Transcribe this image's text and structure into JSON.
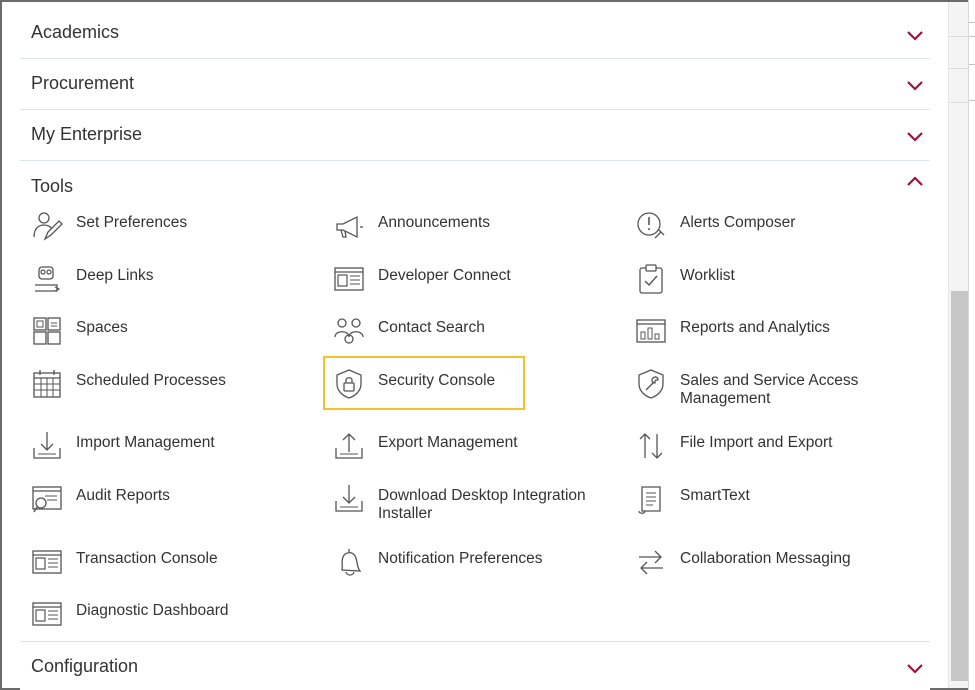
{
  "sections": {
    "academics": "Academics",
    "procurement": "Procurement",
    "my_enterprise": "My Enterprise",
    "tools": "Tools",
    "configuration": "Configuration"
  },
  "tools": {
    "set_preferences": "Set Preferences",
    "announcements": "Announcements",
    "alerts_composer": "Alerts Composer",
    "deep_links": "Deep Links",
    "developer_connect": "Developer Connect",
    "worklist": "Worklist",
    "spaces": "Spaces",
    "contact_search": "Contact Search",
    "reports_and_analytics": "Reports and Analytics",
    "scheduled_processes": "Scheduled Processes",
    "security_console": "Security Console",
    "sales_service_access": "Sales and Service Access Management",
    "import_management": "Import Management",
    "export_management": "Export Management",
    "file_import_export": "File Import and Export",
    "audit_reports": "Audit Reports",
    "download_desktop": "Download Desktop Integration Installer",
    "smarttext": "SmartText",
    "transaction_console": "Transaction Console",
    "notification_preferences": "Notification Preferences",
    "collaboration_messaging": "Collaboration Messaging",
    "diagnostic_dashboard": "Diagnostic Dashboard"
  },
  "icons": {
    "chevron_down": "chevron-down-icon",
    "chevron_up": "chevron-up-icon"
  },
  "colors": {
    "chevron": "#a0123c",
    "highlight": "#f2c12e",
    "icon_stroke": "#555555"
  }
}
